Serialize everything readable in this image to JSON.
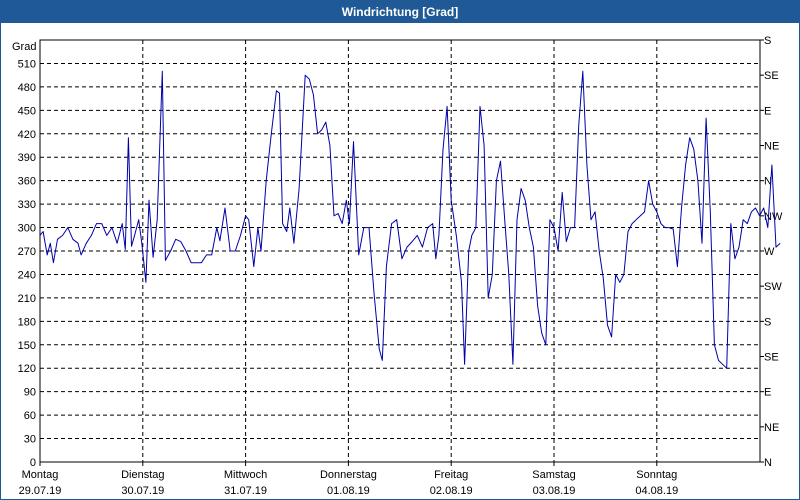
{
  "window": {
    "title": "Windrichtung [Grad]"
  },
  "chart_data": {
    "type": "line",
    "title": "Windrichtung [Grad]",
    "ylabel": "Grad",
    "ylim": [
      0,
      540
    ],
    "yticks": [
      0,
      30,
      60,
      90,
      120,
      150,
      180,
      210,
      240,
      270,
      300,
      330,
      360,
      390,
      420,
      450,
      480,
      510
    ],
    "y2_labels": [
      "N",
      "NE",
      "E",
      "SE",
      "S",
      "SW",
      "W",
      "NW",
      "N",
      "NE",
      "E",
      "SE",
      "S"
    ],
    "grid": true,
    "xlim": [
      0,
      7
    ],
    "x_unit": "days",
    "x_ticks": [
      {
        "day": "Montag",
        "date": "29.07.19"
      },
      {
        "day": "Dienstag",
        "date": "30.07.19"
      },
      {
        "day": "Mittwoch",
        "date": "31.07.19"
      },
      {
        "day": "Donnerstag",
        "date": "01.08.19"
      },
      {
        "day": "Freitag",
        "date": "02.08.19"
      },
      {
        "day": "Samstag",
        "date": "03.08.19"
      },
      {
        "day": "Sonntag",
        "date": "04.08.19"
      }
    ],
    "series": [
      {
        "color": "#0000aa",
        "points": [
          [
            0.0,
            290
          ],
          [
            0.03,
            295
          ],
          [
            0.07,
            265
          ],
          [
            0.1,
            280
          ],
          [
            0.13,
            255
          ],
          [
            0.17,
            285
          ],
          [
            0.22,
            290
          ],
          [
            0.27,
            300
          ],
          [
            0.32,
            285
          ],
          [
            0.37,
            280
          ],
          [
            0.4,
            265
          ],
          [
            0.45,
            280
          ],
          [
            0.5,
            290
          ],
          [
            0.55,
            305
          ],
          [
            0.6,
            305
          ],
          [
            0.65,
            290
          ],
          [
            0.7,
            300
          ],
          [
            0.75,
            280
          ],
          [
            0.8,
            305
          ],
          [
            0.83,
            272
          ],
          [
            0.86,
            415
          ],
          [
            0.89,
            276
          ],
          [
            0.92,
            290
          ],
          [
            0.96,
            310
          ],
          [
            0.99,
            280
          ],
          [
            1.03,
            230
          ],
          [
            1.06,
            335
          ],
          [
            1.1,
            262
          ],
          [
            1.14,
            310
          ],
          [
            1.19,
            500
          ],
          [
            1.22,
            258
          ],
          [
            1.27,
            270
          ],
          [
            1.32,
            285
          ],
          [
            1.37,
            282
          ],
          [
            1.42,
            270
          ],
          [
            1.47,
            255
          ],
          [
            1.52,
            255
          ],
          [
            1.57,
            255
          ],
          [
            1.62,
            265
          ],
          [
            1.67,
            265
          ],
          [
            1.72,
            300
          ],
          [
            1.75,
            283
          ],
          [
            1.8,
            325
          ],
          [
            1.85,
            270
          ],
          [
            1.9,
            270
          ],
          [
            1.95,
            290
          ],
          [
            2.0,
            315
          ],
          [
            2.03,
            310
          ],
          [
            2.08,
            250
          ],
          [
            2.12,
            300
          ],
          [
            2.15,
            270
          ],
          [
            2.2,
            360
          ],
          [
            2.25,
            420
          ],
          [
            2.3,
            475
          ],
          [
            2.33,
            472
          ],
          [
            2.36,
            305
          ],
          [
            2.4,
            295
          ],
          [
            2.43,
            325
          ],
          [
            2.47,
            280
          ],
          [
            2.52,
            350
          ],
          [
            2.58,
            495
          ],
          [
            2.62,
            490
          ],
          [
            2.66,
            470
          ],
          [
            2.7,
            420
          ],
          [
            2.74,
            425
          ],
          [
            2.78,
            435
          ],
          [
            2.82,
            405
          ],
          [
            2.86,
            315
          ],
          [
            2.9,
            318
          ],
          [
            2.94,
            305
          ],
          [
            2.98,
            335
          ],
          [
            3.01,
            305
          ],
          [
            3.05,
            410
          ],
          [
            3.1,
            265
          ],
          [
            3.15,
            300
          ],
          [
            3.2,
            300
          ],
          [
            3.25,
            215
          ],
          [
            3.3,
            145
          ],
          [
            3.33,
            130
          ],
          [
            3.37,
            250
          ],
          [
            3.42,
            305
          ],
          [
            3.47,
            310
          ],
          [
            3.52,
            260
          ],
          [
            3.57,
            275
          ],
          [
            3.62,
            282
          ],
          [
            3.67,
            290
          ],
          [
            3.72,
            275
          ],
          [
            3.77,
            300
          ],
          [
            3.82,
            305
          ],
          [
            3.85,
            260
          ],
          [
            3.88,
            290
          ],
          [
            3.92,
            400
          ],
          [
            3.96,
            455
          ],
          [
            4.0,
            335
          ],
          [
            4.05,
            290
          ],
          [
            4.1,
            230
          ],
          [
            4.13,
            125
          ],
          [
            4.17,
            270
          ],
          [
            4.2,
            290
          ],
          [
            4.24,
            300
          ],
          [
            4.28,
            455
          ],
          [
            4.32,
            405
          ],
          [
            4.36,
            210
          ],
          [
            4.4,
            240
          ],
          [
            4.44,
            360
          ],
          [
            4.48,
            385
          ],
          [
            4.52,
            310
          ],
          [
            4.56,
            240
          ],
          [
            4.6,
            125
          ],
          [
            4.64,
            310
          ],
          [
            4.68,
            350
          ],
          [
            4.72,
            335
          ],
          [
            4.76,
            300
          ],
          [
            4.8,
            275
          ],
          [
            4.84,
            200
          ],
          [
            4.88,
            165
          ],
          [
            4.92,
            150
          ],
          [
            4.96,
            310
          ],
          [
            5.0,
            300
          ],
          [
            5.04,
            270
          ],
          [
            5.08,
            345
          ],
          [
            5.12,
            282
          ],
          [
            5.16,
            300
          ],
          [
            5.2,
            300
          ],
          [
            5.24,
            430
          ],
          [
            5.28,
            500
          ],
          [
            5.32,
            380
          ],
          [
            5.36,
            310
          ],
          [
            5.4,
            320
          ],
          [
            5.44,
            270
          ],
          [
            5.48,
            235
          ],
          [
            5.52,
            175
          ],
          [
            5.56,
            160
          ],
          [
            5.6,
            240
          ],
          [
            5.64,
            230
          ],
          [
            5.68,
            240
          ],
          [
            5.72,
            295
          ],
          [
            5.76,
            305
          ],
          [
            5.8,
            310
          ],
          [
            5.84,
            315
          ],
          [
            5.88,
            320
          ],
          [
            5.92,
            360
          ],
          [
            5.96,
            330
          ],
          [
            6.0,
            320
          ],
          [
            6.04,
            305
          ],
          [
            6.08,
            300
          ],
          [
            6.12,
            300
          ],
          [
            6.16,
            298
          ],
          [
            6.2,
            250
          ],
          [
            6.24,
            325
          ],
          [
            6.28,
            380
          ],
          [
            6.32,
            415
          ],
          [
            6.36,
            400
          ],
          [
            6.4,
            360
          ],
          [
            6.44,
            280
          ],
          [
            6.48,
            440
          ],
          [
            6.52,
            320
          ],
          [
            6.56,
            150
          ],
          [
            6.6,
            130
          ],
          [
            6.64,
            125
          ],
          [
            6.68,
            120
          ],
          [
            6.72,
            305
          ],
          [
            6.76,
            260
          ],
          [
            6.8,
            275
          ],
          [
            6.84,
            310
          ],
          [
            6.88,
            305
          ],
          [
            6.92,
            320
          ],
          [
            6.96,
            325
          ],
          [
            7.0,
            315
          ],
          [
            7.04,
            325
          ],
          [
            7.08,
            300
          ],
          [
            7.12,
            380
          ],
          [
            7.16,
            275
          ],
          [
            7.2,
            280
          ]
        ]
      }
    ]
  }
}
